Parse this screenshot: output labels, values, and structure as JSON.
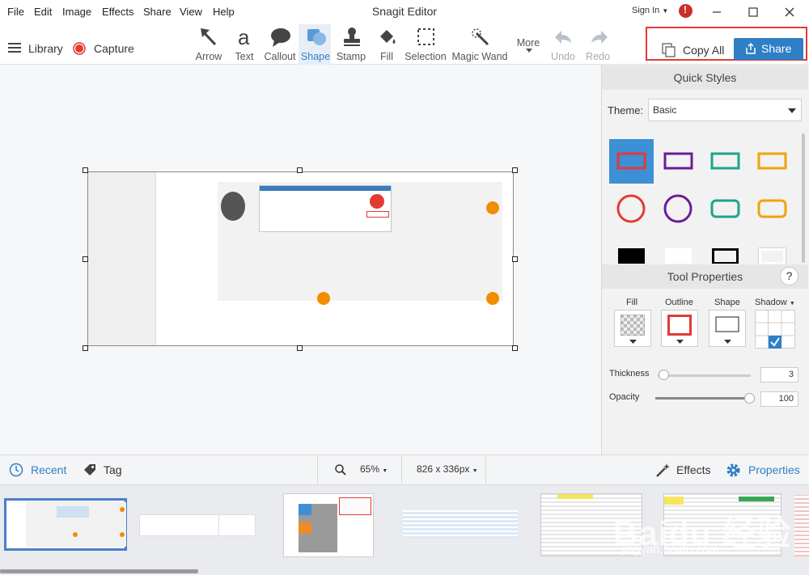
{
  "menu": {
    "file": "File",
    "edit": "Edit",
    "image": "Image",
    "effects": "Effects",
    "share": "Share",
    "view": "View",
    "help": "Help"
  },
  "app_title": "Snagit Editor",
  "sign_in": "Sign In",
  "toolbar": {
    "library": "Library",
    "capture": "Capture",
    "tools": [
      {
        "label": "Arrow",
        "icon": "arrow-icon"
      },
      {
        "label": "Text",
        "icon": "text-icon"
      },
      {
        "label": "Callout",
        "icon": "callout-icon"
      },
      {
        "label": "Shape",
        "icon": "shape-icon"
      },
      {
        "label": "Stamp",
        "icon": "stamp-icon"
      },
      {
        "label": "Fill",
        "icon": "fill-icon"
      },
      {
        "label": "Selection",
        "icon": "selection-icon"
      },
      {
        "label": "Magic Wand",
        "icon": "magic-wand-icon"
      },
      {
        "label": "More",
        "icon": "chevron-down-icon"
      },
      {
        "label": "Undo",
        "icon": "undo-icon"
      },
      {
        "label": "Redo",
        "icon": "redo-icon"
      }
    ],
    "copy_all": "Copy All",
    "share": "Share"
  },
  "quick_styles": {
    "title": "Quick Styles",
    "theme_label": "Theme:",
    "theme_value": "Basic"
  },
  "tool_properties": {
    "title": "Tool Properties",
    "help": "?",
    "fill": "Fill",
    "outline": "Outline",
    "shape": "Shape",
    "shadow": "Shadow",
    "thickness_label": "Thickness",
    "thickness_value": "3",
    "opacity_label": "Opacity",
    "opacity_value": "100"
  },
  "bottom": {
    "recent": "Recent",
    "tag": "Tag",
    "zoom": "65%",
    "dimensions": "826 x 336px",
    "effects": "Effects",
    "properties": "Properties"
  },
  "colors": {
    "accent": "#2f7fc6",
    "red": "#e53935",
    "purple": "#6a1b9a",
    "teal": "#1aa58b",
    "orange": "#f0a30a"
  },
  "watermark": {
    "brand": "Baidu 经验",
    "url": "jingyan.baidu.com"
  }
}
